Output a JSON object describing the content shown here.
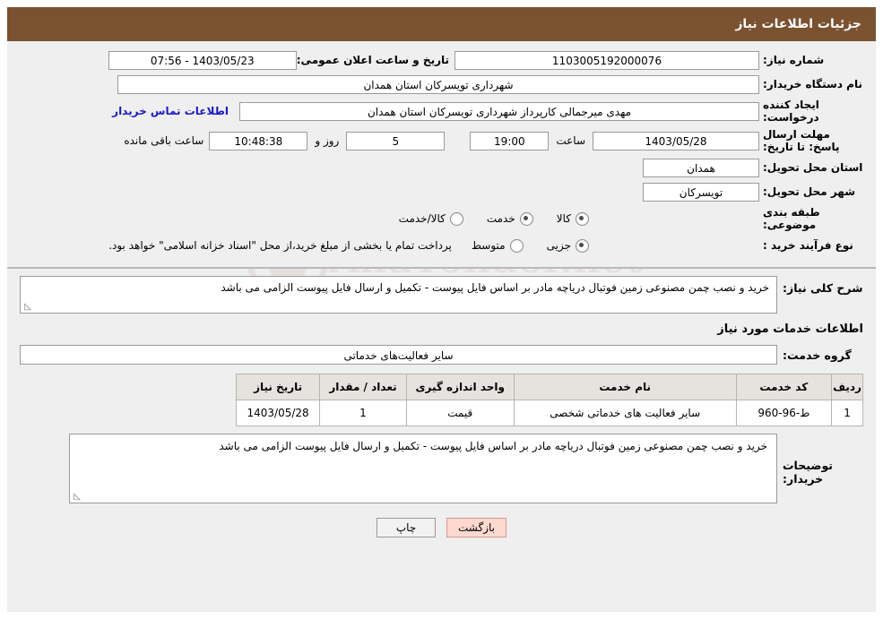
{
  "header": {
    "title": "جزئیات اطلاعات نیاز"
  },
  "watermark": {
    "text": "AnaTender.net",
    "icon": "shield-icon"
  },
  "info": {
    "need_number_label": "شماره نیاز:",
    "need_number_value": "1103005192000076",
    "public_announce_label": "تاریخ و ساعت اعلان عمومی:",
    "public_announce_value": "1403/05/23 - 07:56",
    "buyer_org_label": "نام دستگاه خریدار:",
    "buyer_org_value": "شهرداری تویسرکان استان همدان",
    "creator_label": "ایجاد کننده درخواست:",
    "creator_value": "مهدی میرجمالی کارپرداز شهرداری تویسرکان استان همدان",
    "contact_link": "اطلاعات تماس خریدار",
    "deadline_label": "مهلت ارسال پاسخ: تا تاریخ:",
    "deadline_date": "1403/05/28",
    "deadline_hour_label": "ساعت",
    "deadline_hour": "19:00",
    "days_value": "5",
    "days_label": "روز و",
    "remaining_time": "10:48:38",
    "remaining_label": "ساعت باقی مانده",
    "province_label": "استان محل تحویل:",
    "province_value": "همدان",
    "city_label": "شهر محل تحویل:",
    "city_value": "تویسرکان",
    "category_label": "طبقه بندی موضوعی:",
    "category_options": [
      {
        "label": "کالا",
        "selected": true
      },
      {
        "label": "خدمت",
        "selected": false
      },
      {
        "label": "کالا/خدمت",
        "selected": false
      }
    ],
    "purchase_type_label": "نوع فرآیند خرید :",
    "purchase_type_options": [
      {
        "label": "جزیی",
        "selected": true
      },
      {
        "label": "متوسط",
        "selected": false
      }
    ],
    "purchase_note": "پرداخت تمام یا بخشی از مبلغ خرید،از محل \"اسناد خزانه اسلامی\" خواهد بود."
  },
  "main": {
    "general_desc_label": "شرح کلی نیاز:",
    "general_desc_value": "خرید و نصب چمن مصنوعی زمین فوتبال دریاچه مادر بر اساس فایل پیوست - تکمیل و ارسال فایل پیوست الزامی می باشد",
    "services_title": "اطلاعات خدمات مورد نیاز",
    "service_group_label": "گروه خدمت:",
    "service_group_value": "سایر فعالیت‌های خدماتی",
    "table": {
      "headers": [
        "ردیف",
        "کد خدمت",
        "نام خدمت",
        "واحد اندازه گیری",
        "تعداد / مقدار",
        "تاریخ نیاز"
      ],
      "rows": [
        {
          "row_no": "1",
          "service_code": "ط-96-960",
          "service_name": "سایر فعالیت های خدماتی شخصی",
          "unit": "قیمت",
          "quantity": "1",
          "need_date": "1403/05/28"
        }
      ]
    },
    "buyer_notes_label": "توضیحات خریدار:",
    "buyer_notes_value": "خرید و نصب چمن مصنوعی زمین فوتبال دریاچه مادر بر اساس فایل پیوست - تکمیل و ارسال فایل پیوست الزامی می باشد"
  },
  "footer": {
    "print_button": "چاپ",
    "back_button": "بازگشت"
  }
}
